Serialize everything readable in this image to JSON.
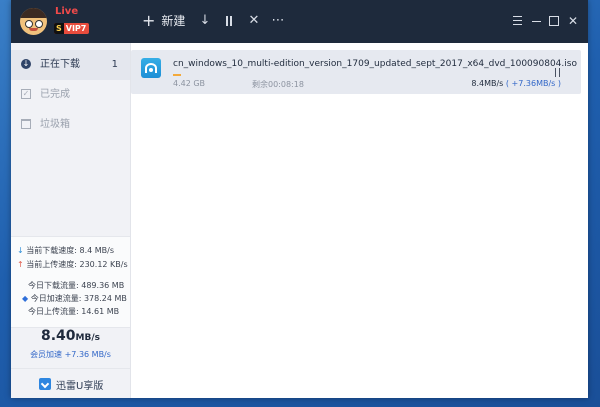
{
  "titlebar": {
    "live_label": "Live",
    "vip_s": "S",
    "vip_label": "VIP7",
    "new_label": "新建",
    "icons": [
      "download-arrow-icon",
      "pause-all-icon",
      "delete-icon",
      "more-icon"
    ],
    "window_controls": [
      "menu-icon",
      "minimize-icon",
      "maximize-icon",
      "close-icon"
    ]
  },
  "sidebar": {
    "items": [
      {
        "label": "正在下载",
        "count": "1",
        "icon": "download-circle-icon"
      },
      {
        "label": "已完成",
        "icon": "check-box-icon"
      },
      {
        "label": "垃圾箱",
        "icon": "trash-icon"
      }
    ],
    "stats": {
      "current_download_label": "当前下载速度:",
      "current_download_value": "8.4 MB/s",
      "current_upload_label": "当前上传速度:",
      "current_upload_value": "230.12 KB/s",
      "today_download_label": "今日下载流量:",
      "today_download_value": "489.36 MB",
      "today_accel_label": "今日加速流量:",
      "today_accel_value": "378.24 MB",
      "today_upload_label": "今日上传流量:",
      "today_upload_value": "14.61 MB"
    },
    "big_speed_value": "8.40",
    "big_speed_unit": "MB/s",
    "vip_accel": "会员加速 +7.36 MB/s",
    "brand_label": "迅雷U享版"
  },
  "task": {
    "file_name": "cn_windows_10_multi-edition_version_1709_updated_sept_2017_x64_dvd_100090804.iso",
    "size": "4.42 GB",
    "remaining": "剩余00:08:18",
    "speed": "8.4MB/s",
    "accel": "( +7.36MB/s )",
    "progress": 0.13
  },
  "colors": {
    "titlebar": "#1e2a3c",
    "accent_blue": "#3267c8",
    "progress": "#f3a93b",
    "live_red": "#f04a4a"
  }
}
